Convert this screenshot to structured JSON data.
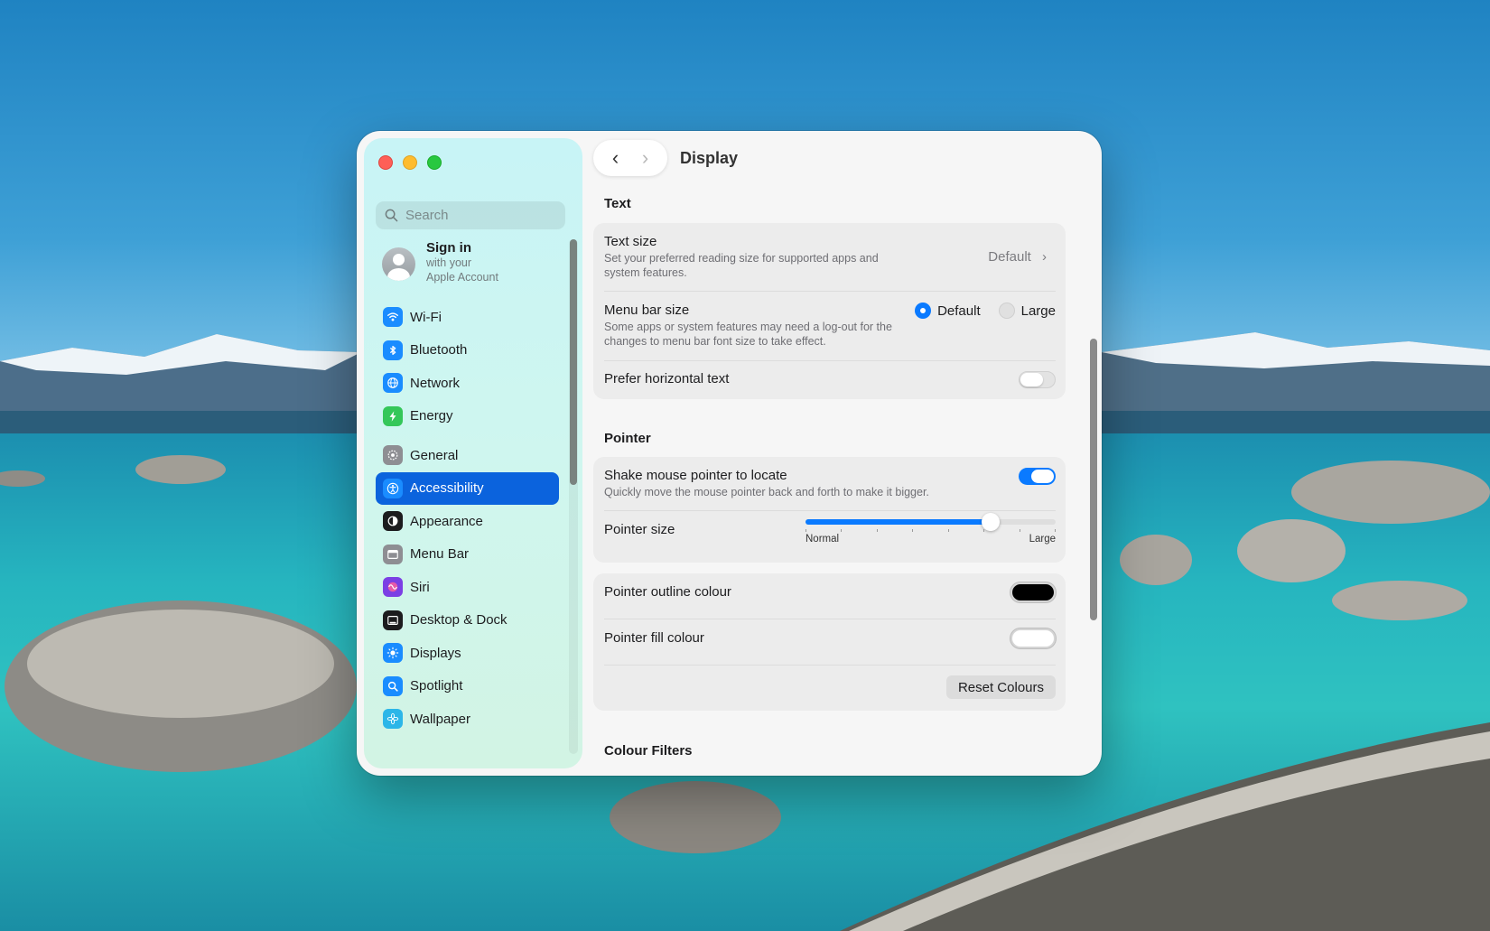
{
  "window": {
    "title": "Display",
    "nav_back": "‹",
    "nav_forward": "›"
  },
  "sidebar": {
    "search_placeholder": "Search",
    "account": {
      "title": "Sign in",
      "line1": "with your",
      "line2": "Apple Account"
    },
    "groups": [
      [
        {
          "label": "Wi-Fi",
          "icon": "wifi-icon",
          "color": "#1a8cff"
        },
        {
          "label": "Bluetooth",
          "icon": "bluetooth-icon",
          "color": "#1a8cff"
        },
        {
          "label": "Network",
          "icon": "globe-icon",
          "color": "#1a8cff"
        },
        {
          "label": "Energy",
          "icon": "bolt-icon",
          "color": "#34c759"
        }
      ],
      [
        {
          "label": "General",
          "icon": "gear-icon",
          "color": "#8e8e93"
        },
        {
          "label": "Accessibility",
          "icon": "accessibility-icon",
          "color": "#1a8cff",
          "active": true
        },
        {
          "label": "Appearance",
          "icon": "appearance-icon",
          "color": "#1c1c1e"
        },
        {
          "label": "Menu Bar",
          "icon": "menubar-icon",
          "color": "#8e8e93"
        },
        {
          "label": "Siri",
          "icon": "siri-icon",
          "color": "#7b3fe4"
        },
        {
          "label": "Desktop & Dock",
          "icon": "dock-icon",
          "color": "#1c1c1e"
        },
        {
          "label": "Displays",
          "icon": "sun-icon",
          "color": "#1a8cff"
        },
        {
          "label": "Spotlight",
          "icon": "magnifier-icon",
          "color": "#1a8cff"
        },
        {
          "label": "Wallpaper",
          "icon": "flower-icon",
          "color": "#2cb6e8"
        }
      ]
    ]
  },
  "sections": {
    "text": {
      "heading": "Text",
      "text_size": {
        "title": "Text size",
        "desc": "Set your preferred reading size for supported apps and system features.",
        "value": "Default"
      },
      "menu_bar_size": {
        "title": "Menu bar size",
        "desc": "Some apps or system features may need a log-out for the changes to menu bar font size to take effect.",
        "options": [
          "Default",
          "Large"
        ],
        "selected": "Default"
      },
      "prefer_horizontal": {
        "title": "Prefer horizontal text",
        "enabled": false
      }
    },
    "pointer": {
      "heading": "Pointer",
      "shake": {
        "title": "Shake mouse pointer to locate",
        "desc": "Quickly move the mouse pointer back and forth to make it bigger.",
        "enabled": true
      },
      "size": {
        "title": "Pointer size",
        "min_label": "Normal",
        "max_label": "Large",
        "value_fraction": 0.74
      },
      "outline": {
        "title": "Pointer outline colour",
        "color": "#000000"
      },
      "fill": {
        "title": "Pointer fill colour",
        "color": "#ffffff"
      },
      "reset_label": "Reset Colours"
    },
    "colour_filters": {
      "heading": "Colour Filters"
    }
  },
  "colors": {
    "accent": "#0a7aff",
    "sidebar_active": "#0b63dd"
  }
}
